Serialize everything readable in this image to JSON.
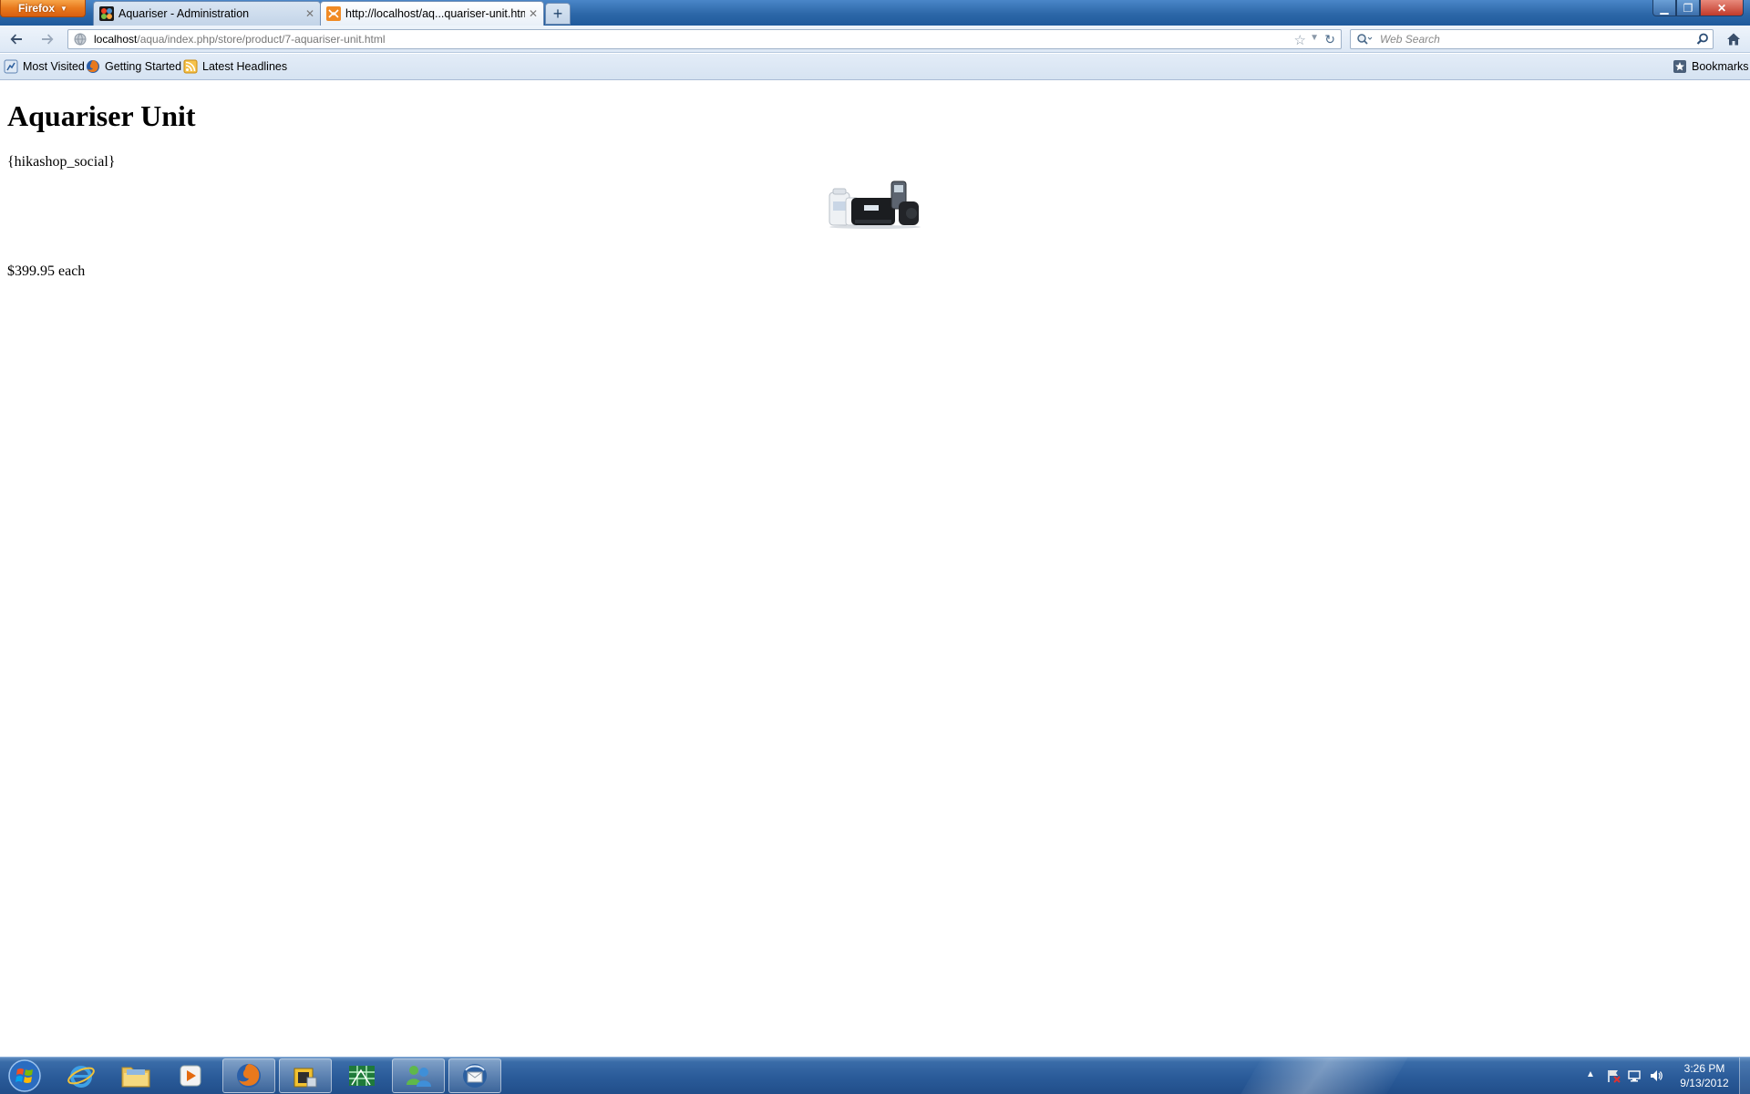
{
  "browser": {
    "menu_button_label": "Firefox",
    "tabs": [
      {
        "label": "Aquariser - Administration",
        "favicon": "joomla-icon",
        "active": false
      },
      {
        "label": "http://localhost/aq...quariser-unit.html",
        "favicon": "hikashop-icon",
        "active": true
      }
    ],
    "new_tab_label": "+",
    "url": {
      "host": "localhost",
      "path": "/aqua/index.php/store/product/7-aquariser-unit.html"
    },
    "search": {
      "placeholder": "Web Search"
    },
    "bookmarks": [
      {
        "label": "Most Visited",
        "icon": "most-visited-icon"
      },
      {
        "label": "Getting Started",
        "icon": "firefox-icon"
      },
      {
        "label": "Latest Headlines",
        "icon": "rss-icon"
      }
    ],
    "bookmarks_menu_label": "Bookmarks"
  },
  "page": {
    "title": "Aquariser Unit",
    "social_placeholder": "{hikashop_social}",
    "price": "$399.95 each"
  },
  "taskbar": {
    "apps": [
      {
        "name": "internet-explorer-icon",
        "active": false
      },
      {
        "name": "file-explorer-icon",
        "active": false
      },
      {
        "name": "media-player-icon",
        "active": false
      },
      {
        "name": "firefox-icon",
        "active": true
      },
      {
        "name": "ftp-client-icon",
        "active": true
      },
      {
        "name": "spreadsheet-app-icon",
        "active": false
      },
      {
        "name": "messenger-icon",
        "active": true
      },
      {
        "name": "thunderbird-icon",
        "active": true
      }
    ],
    "clock": {
      "time": "3:26 PM",
      "date": "9/13/2012"
    },
    "colors": {
      "taskbar": "#2a5b99",
      "firefox_button": "#e8791d",
      "titlebar": "#2c67a8"
    }
  }
}
